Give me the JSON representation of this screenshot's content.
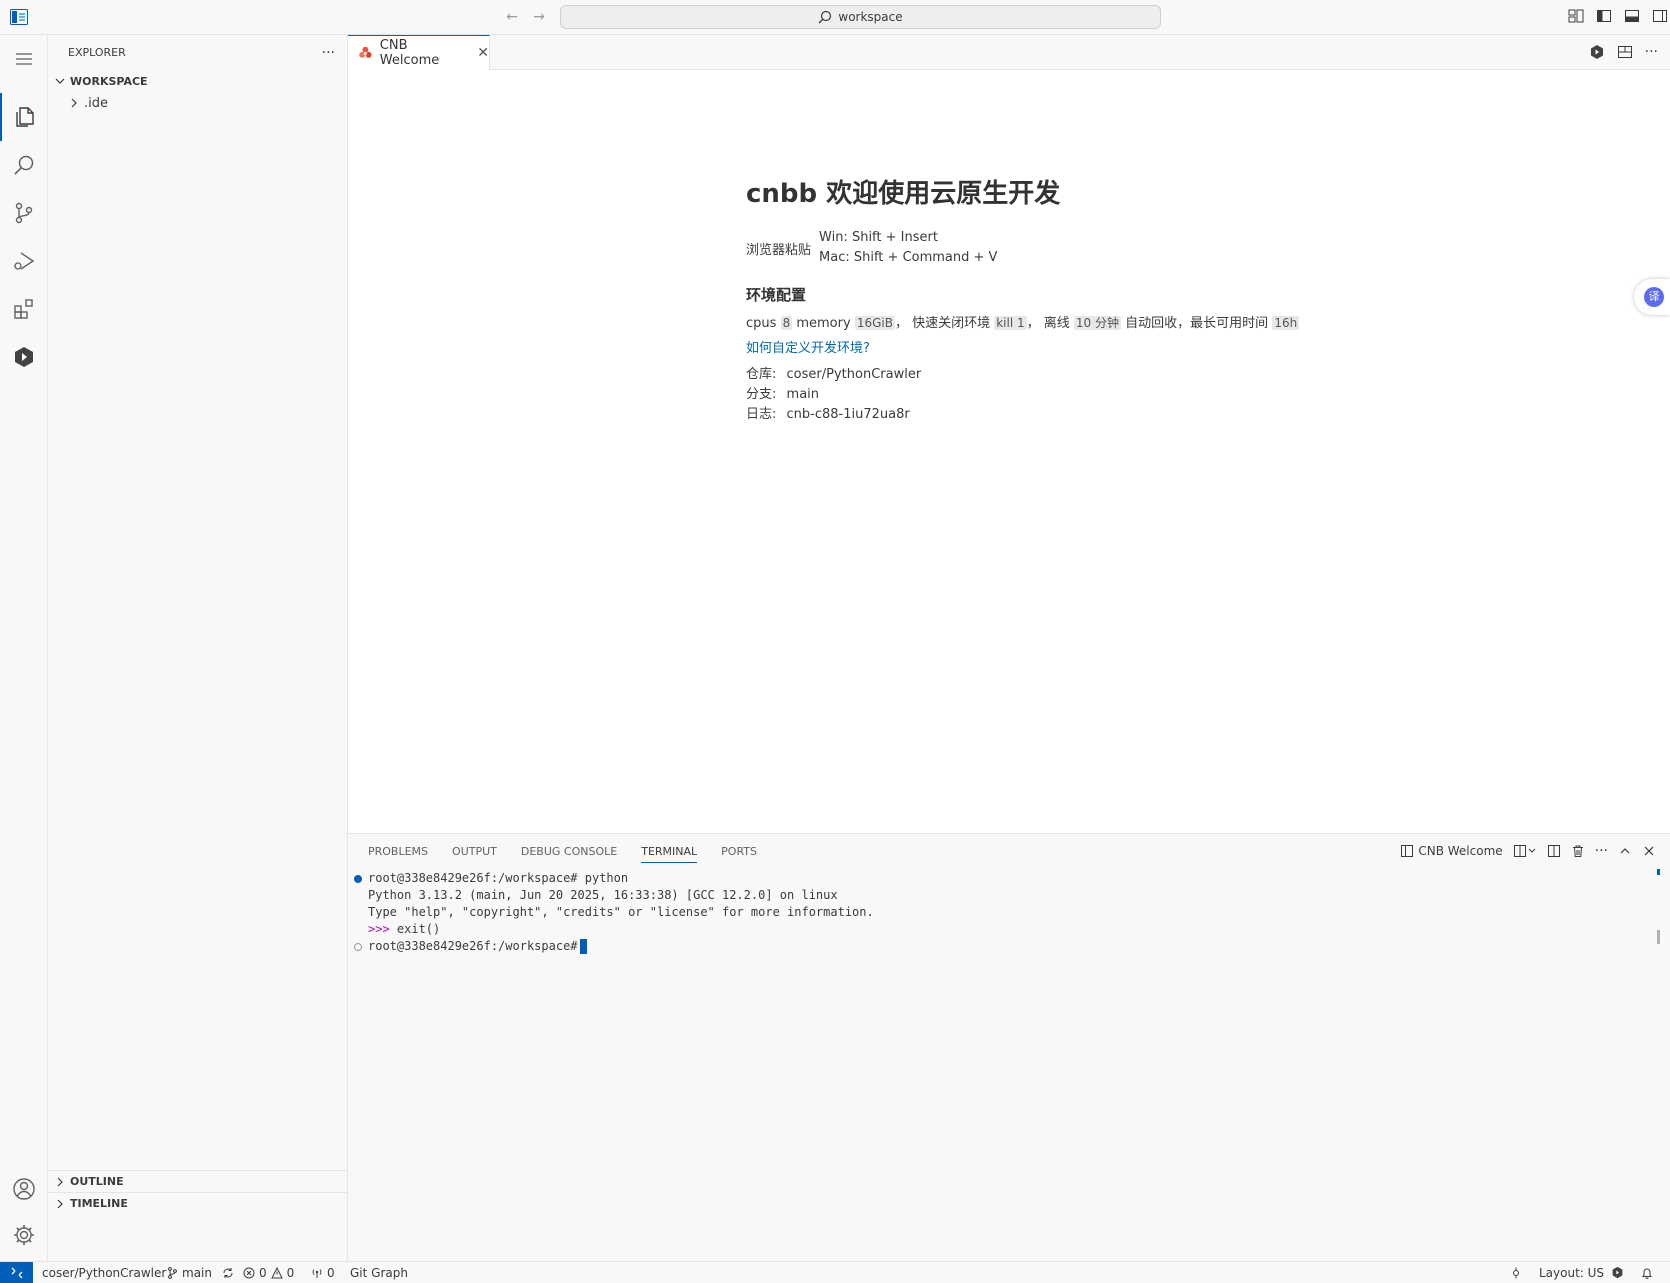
{
  "titlebar": {
    "search_text": "workspace"
  },
  "sidebar": {
    "title": "EXPLORER",
    "more_label": "···",
    "workspace_label": "WORKSPACE",
    "folder_ide": ".ide",
    "outline_label": "OUTLINE",
    "timeline_label": "TIMELINE"
  },
  "editor": {
    "tab_label": "CNB Welcome",
    "tab_close": "✕",
    "more_label": "···"
  },
  "welcome": {
    "title": "cnbb 欢迎使用云原生开发",
    "paste_label": "浏览器粘贴",
    "paste_win": "Win: Shift + Insert",
    "paste_mac": "Mac: Shift + Command + V",
    "env_heading": "环境配置",
    "env": {
      "cpus_label": "cpus",
      "cpus_value": "8",
      "memory_label": "memory",
      "memory_value": "16GiB",
      "quick_close_label": "， 快速关闭环境",
      "kill_value": "kill 1",
      "offline_label": "， 离线",
      "offline_value": "10 分钟",
      "auto_recycle_label": "自动回收，最长可用时间",
      "max_time_value": "16h"
    },
    "customize_link": "如何自定义开发环境?",
    "repo_label": "仓库:",
    "repo_value": "coser/PythonCrawler",
    "branch_label": "分支:",
    "branch_value": "main",
    "log_label": "日志:",
    "log_value": "cnb-c88-1iu72ua8r",
    "translate_icon_text": "译"
  },
  "panel": {
    "tabs": [
      "PROBLEMS",
      "OUTPUT",
      "DEBUG CONSOLE",
      "TERMINAL",
      "PORTS"
    ],
    "terminal_name": "CNB Welcome",
    "more_label": "···"
  },
  "terminal": {
    "line1": "root@338e8429e26f:/workspace# python",
    "line2": "Python 3.13.2 (main, Jun 20 2025, 16:33:38) [GCC 12.2.0] on linux",
    "line3": "Type \"help\", \"copyright\", \"credits\" or \"license\" for more information.",
    "line4_prompt": ">>>",
    "line4_cmd": " exit()",
    "line5": "root@338e8429e26f:/workspace#"
  },
  "statusbar": {
    "repo": "coser/PythonCrawler",
    "branch": "main",
    "errors": "0",
    "warnings": "0",
    "ports": "0",
    "git_graph": "Git Graph",
    "layout": "Layout: US"
  },
  "colors": {
    "accent": "#005fb8",
    "tab_icon": "#e8553e",
    "link": "#006ab1"
  }
}
